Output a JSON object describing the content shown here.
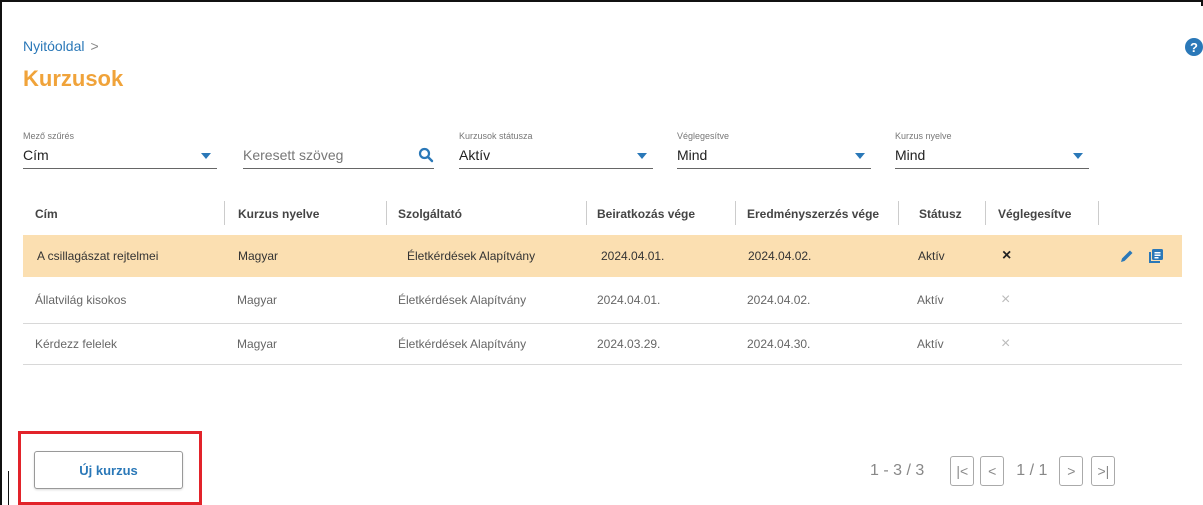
{
  "breadcrumb": {
    "home": "Nyitóoldal",
    "separator": ">"
  },
  "page": {
    "title": "Kurzusok"
  },
  "help": {
    "glyph": "?"
  },
  "filters": {
    "field": {
      "label": "Mező szűrés",
      "value": "Cím"
    },
    "search": {
      "placeholder": "Keresett szöveg"
    },
    "status": {
      "label": "Kurzusok státusza",
      "value": "Aktív"
    },
    "finalized": {
      "label": "Véglegesítve",
      "value": "Mind"
    },
    "language": {
      "label": "Kurzus nyelve",
      "value": "Mind"
    }
  },
  "table": {
    "headers": [
      "Cím",
      "Kurzus nyelve",
      "Szolgáltató",
      "Beiratkozás vége",
      "Eredményszerzés vége",
      "Státusz",
      "Véglegesítve"
    ],
    "rows": [
      [
        "A csillagászat rejtelmei",
        "Magyar",
        "Életkérdések Alapítvány",
        "2024.04.01.",
        "2024.04.02.",
        "Aktív",
        "×"
      ],
      [
        "Állatvilág kisokos",
        "Magyar",
        "Életkérdések Alapítvány",
        "2024.04.01.",
        "2024.04.02.",
        "Aktív",
        "×"
      ],
      [
        "Kérdezz felelek",
        "Magyar",
        "Életkérdések Alapítvány",
        "2024.03.29.",
        "2024.04.30.",
        "Aktív",
        "×"
      ]
    ]
  },
  "actions": {
    "new_course": "Új kurzus"
  },
  "pagination": {
    "range": "1 - 3 / 3",
    "page": "1 / 1",
    "first": "|<",
    "prev": "<",
    "next": ">",
    "last": ">|"
  },
  "colors": {
    "accent": "#2a78b8",
    "title": "#f0a33a",
    "selected_row": "#fbdfb1",
    "highlight": "#e2232a"
  }
}
